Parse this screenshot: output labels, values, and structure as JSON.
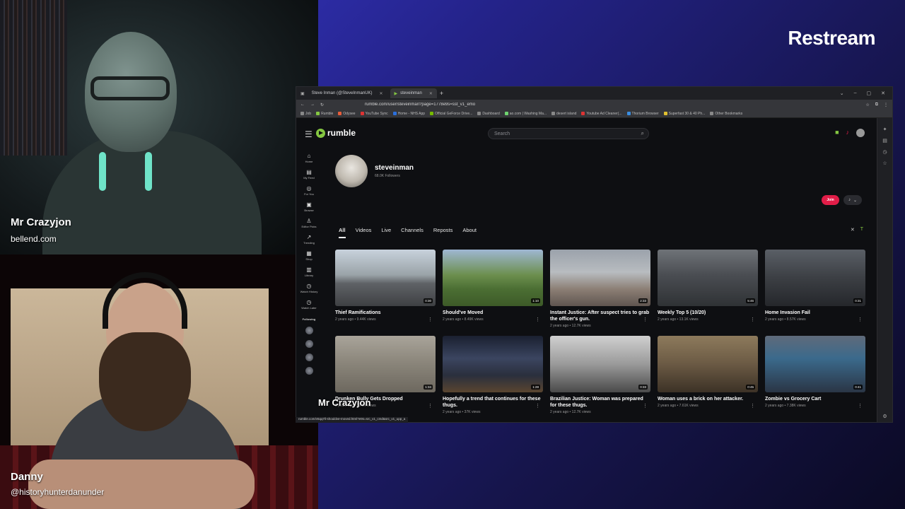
{
  "stream": {
    "brand": "Restream",
    "host1": {
      "name": "Mr Crazyjon",
      "handle": "bellend.com"
    },
    "host2": {
      "name": "Danny",
      "handle": "@historyhunterdanunder"
    },
    "overlay_name": "Mr Crazyjon"
  },
  "browser": {
    "tabs": [
      {
        "label": "Steve Inman (@SteveInmanUK)",
        "active": false
      },
      {
        "label": "steveinman",
        "active": true
      }
    ],
    "new_tab": "+",
    "address": "rumble.com/user/steveinman?page=1778e9s=sst_v1_emo",
    "bookmarks": [
      "Job",
      "Rumble",
      "Odysee",
      "YouTube Sync",
      "Home - NHS App",
      "Official GeForce Drive...",
      "Dashboard",
      "ao.com | Washing Ma...",
      "desert island",
      "Youtube Ad Cleaner(...",
      "Thorium Browser",
      "Superfast 30 & 40 Ph...",
      "Other Bookmarks"
    ],
    "status_url": "rumble.com/v5qq7il-shouldve-moved.html?e9s=src_v1_cmd&src_v1_upp_a"
  },
  "site": {
    "logo": "rumble",
    "search_placeholder": "Search",
    "left_nav": [
      {
        "label": "Home",
        "icon": "⌂"
      },
      {
        "label": "My Feed",
        "icon": "▤"
      },
      {
        "label": "For You",
        "icon": "◎"
      },
      {
        "label": "Browse",
        "icon": "▣"
      },
      {
        "label": "Editor Picks",
        "icon": "♙"
      },
      {
        "label": "Trending",
        "icon": "↗"
      },
      {
        "label": "Shop",
        "icon": "▦"
      },
      {
        "label": "Library",
        "icon": "▥"
      },
      {
        "label": "Watch History",
        "icon": "◷"
      },
      {
        "label": "Watch Later",
        "icon": "◷"
      }
    ],
    "following_label": "Following"
  },
  "channel": {
    "name": "steveinman",
    "followers": "68.0K Followers",
    "join_label": "Join",
    "tabs": [
      "All",
      "Videos",
      "Live",
      "Channels",
      "Reposts",
      "About"
    ],
    "active_tab": "All"
  },
  "videos": [
    {
      "title": "Thief Ramifications",
      "meta": "2 years ago • 9.44K views",
      "duration": "0:30",
      "bg": "linear-gradient(180deg,#c8d2dc 0%,#9aa3a8 45%,#5f6266 60%,#3e4043 100%)"
    },
    {
      "title": "Should've Moved",
      "meta": "2 years ago • 8.49K views",
      "duration": "1:10",
      "bg": "linear-gradient(180deg,#9fb7d3 0%,#6c8f4e 45%,#4b6e33 70%,#3d5a28 100%)"
    },
    {
      "title": "Instant Justice: After suspect tries to grab the officer's gun.",
      "meta": "2 years ago • 12.7K views",
      "duration": "2:33",
      "bg": "linear-gradient(180deg,#9ba2ab 0%,#b8bcc0 40%,#8c7f75 70%,#5f5550 100%)"
    },
    {
      "title": "Weekly Top 5 (10/20)",
      "meta": "2 years ago • 13.1K views",
      "duration": "5:46",
      "bg": "linear-gradient(180deg,#6f7378 0%,#4a4d52 45%,#2f3235 100%)"
    },
    {
      "title": "Home Invasion Fail",
      "meta": "2 years ago • 8.57K views",
      "duration": "0:31",
      "bg": "linear-gradient(180deg,#5a5f66 0%,#3c3f44 50%,#25272b 100%)"
    },
    {
      "title": "Drunken Bully Gets Dropped",
      "meta": "2 years ago • 12.9K views",
      "duration": "1:34",
      "bg": "linear-gradient(180deg,#a9a49a 0%,#8c877c 45%,#6d685f 100%)"
    },
    {
      "title": "Hopefully a trend that continues for these thugs.",
      "meta": "2 years ago • 37K views",
      "duration": "1:28",
      "bg": "linear-gradient(180deg,#1a2030 0%,#3b4560 40%,#2a2f3d 70%,#5a4530 100%)"
    },
    {
      "title": "Brazilian Justice: Woman was prepared for these thugs.",
      "meta": "2 years ago • 12.7K views",
      "duration": "0:33",
      "bg": "linear-gradient(180deg,#d0d0d0 0%,#9a9a9a 50%,#4a4a4a 100%)"
    },
    {
      "title": "Woman uses a brick on her attacker.",
      "meta": "2 years ago • 7.61K views",
      "duration": "0:45",
      "bg": "linear-gradient(180deg,#8d7a5c 0%,#6b5a44 50%,#3c3226 100%)"
    },
    {
      "title": "Zombie vs Grocery Cart",
      "meta": "2 years ago • 7.38K views",
      "duration": "0:41",
      "bg": "linear-gradient(180deg,#5f6a7a 0%,#3b6a8c 40%,#2a3545 100%)"
    },
    {
      "title": "",
      "meta": "",
      "duration": "",
      "bg": "linear-gradient(180deg,#7a6a5a 0%,#c23a3a 50%,#4a4040 100%)"
    },
    {
      "title": "",
      "meta": "",
      "duration": "",
      "bg": "linear-gradient(180deg,#b08a50 0%,#7a5a3a 60%,#4a3a2a 100%)"
    },
    {
      "title": "",
      "meta": "",
      "duration": "",
      "bg": "linear-gradient(180deg,#3a3a3a 0%,#c8b820 55%,#2a2a2a 100%)"
    },
    {
      "title": "",
      "meta": "",
      "duration": "",
      "bg": "linear-gradient(180deg,#2a2a2a 0%,#5a4a40 60%,#3a2e28 100%)"
    },
    {
      "title": "",
      "meta": "",
      "duration": "",
      "bg": "linear-gradient(180deg,#8aa0c8 0%,#6a80a8 100%)"
    }
  ],
  "colors": {
    "rumble_green": "#85c742",
    "join_red": "#e11d48",
    "restream_bg": "#24238a"
  }
}
